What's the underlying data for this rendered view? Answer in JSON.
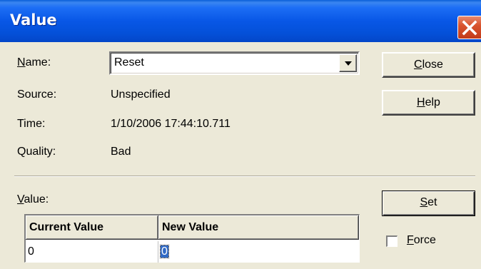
{
  "window": {
    "title": "Value"
  },
  "fields": {
    "name_label_mnemonic": "N",
    "name_label_rest": "ame:",
    "name_value": "Reset",
    "source_label": "Source:",
    "source_value": "Unspecified",
    "time_label": "Time:",
    "time_value": "1/10/2006 17:44:10.711",
    "quality_label": "Quality:",
    "quality_value": "Bad"
  },
  "buttons": {
    "close_mnemonic": "C",
    "close_rest": "lose",
    "help_mnemonic": "H",
    "help_rest": "elp",
    "set_mnemonic": "S",
    "set_rest": "et"
  },
  "value_section": {
    "label_mnemonic": "V",
    "label_rest": "alue:",
    "columns": [
      "Current Value",
      "New Value"
    ],
    "current_value": "0",
    "new_value": "0"
  },
  "force": {
    "label_mnemonic": "F",
    "label_rest": "orce",
    "checked": false
  },
  "icons": [
    "close-icon",
    "dropdown-arrow-icon"
  ]
}
